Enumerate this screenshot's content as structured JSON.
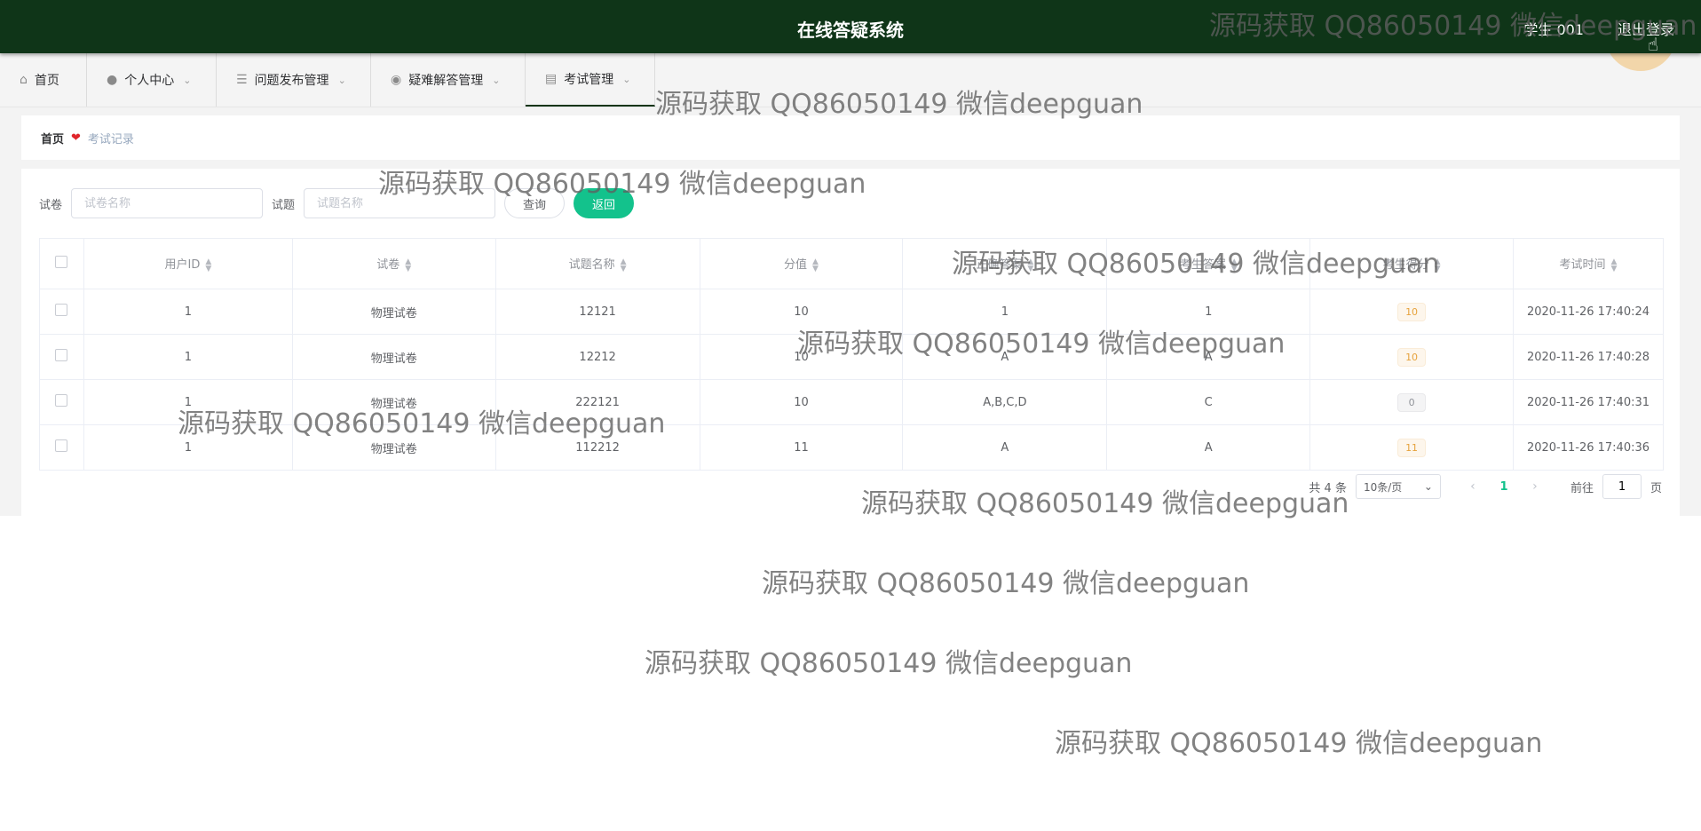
{
  "header": {
    "title": "在线答疑系统",
    "user": "学生 001",
    "logout": "退出登录"
  },
  "nav": [
    {
      "label": "首页",
      "icon": "home-icon"
    },
    {
      "label": "个人中心",
      "icon": "user-icon"
    },
    {
      "label": "问题发布管理",
      "icon": "list-icon"
    },
    {
      "label": "疑难解答管理",
      "icon": "bulb-icon"
    },
    {
      "label": "考试管理",
      "icon": "clipboard-icon"
    }
  ],
  "breadcrumb": {
    "home": "首页",
    "current": "考试记录"
  },
  "search": {
    "paper_label": "试卷",
    "paper_placeholder": "试卷名称",
    "question_label": "试题",
    "question_placeholder": "试题名称",
    "query_button": "查询",
    "back_button": "返回"
  },
  "table": {
    "columns": [
      "用户ID",
      "试卷",
      "试题名称",
      "分值",
      "正确答案",
      "考生答案",
      "考生得分",
      "考试时间"
    ],
    "rows": [
      [
        "1",
        "物理试卷",
        "12121",
        "10",
        "1",
        "1",
        "10",
        "2020-11-26 17:40:24"
      ],
      [
        "1",
        "物理试卷",
        "12212",
        "10",
        "A",
        "A",
        "10",
        "2020-11-26 17:40:28"
      ],
      [
        "1",
        "物理试卷",
        "222121",
        "10",
        "A,B,C,D",
        "C",
        "0",
        "2020-11-26 17:40:31"
      ],
      [
        "1",
        "物理试卷",
        "112212",
        "11",
        "A",
        "A",
        "11",
        "2020-11-26 17:40:36"
      ]
    ]
  },
  "pagination": {
    "total": "共 4 条",
    "page_size": "10条/页",
    "current": "1",
    "goto_label": "前往",
    "goto_value": "1",
    "page_suffix": "页"
  },
  "watermark": "源码获取 QQ86050149 微信deepguan",
  "colors": {
    "header": "#0f3518",
    "accent": "#13c28c"
  }
}
